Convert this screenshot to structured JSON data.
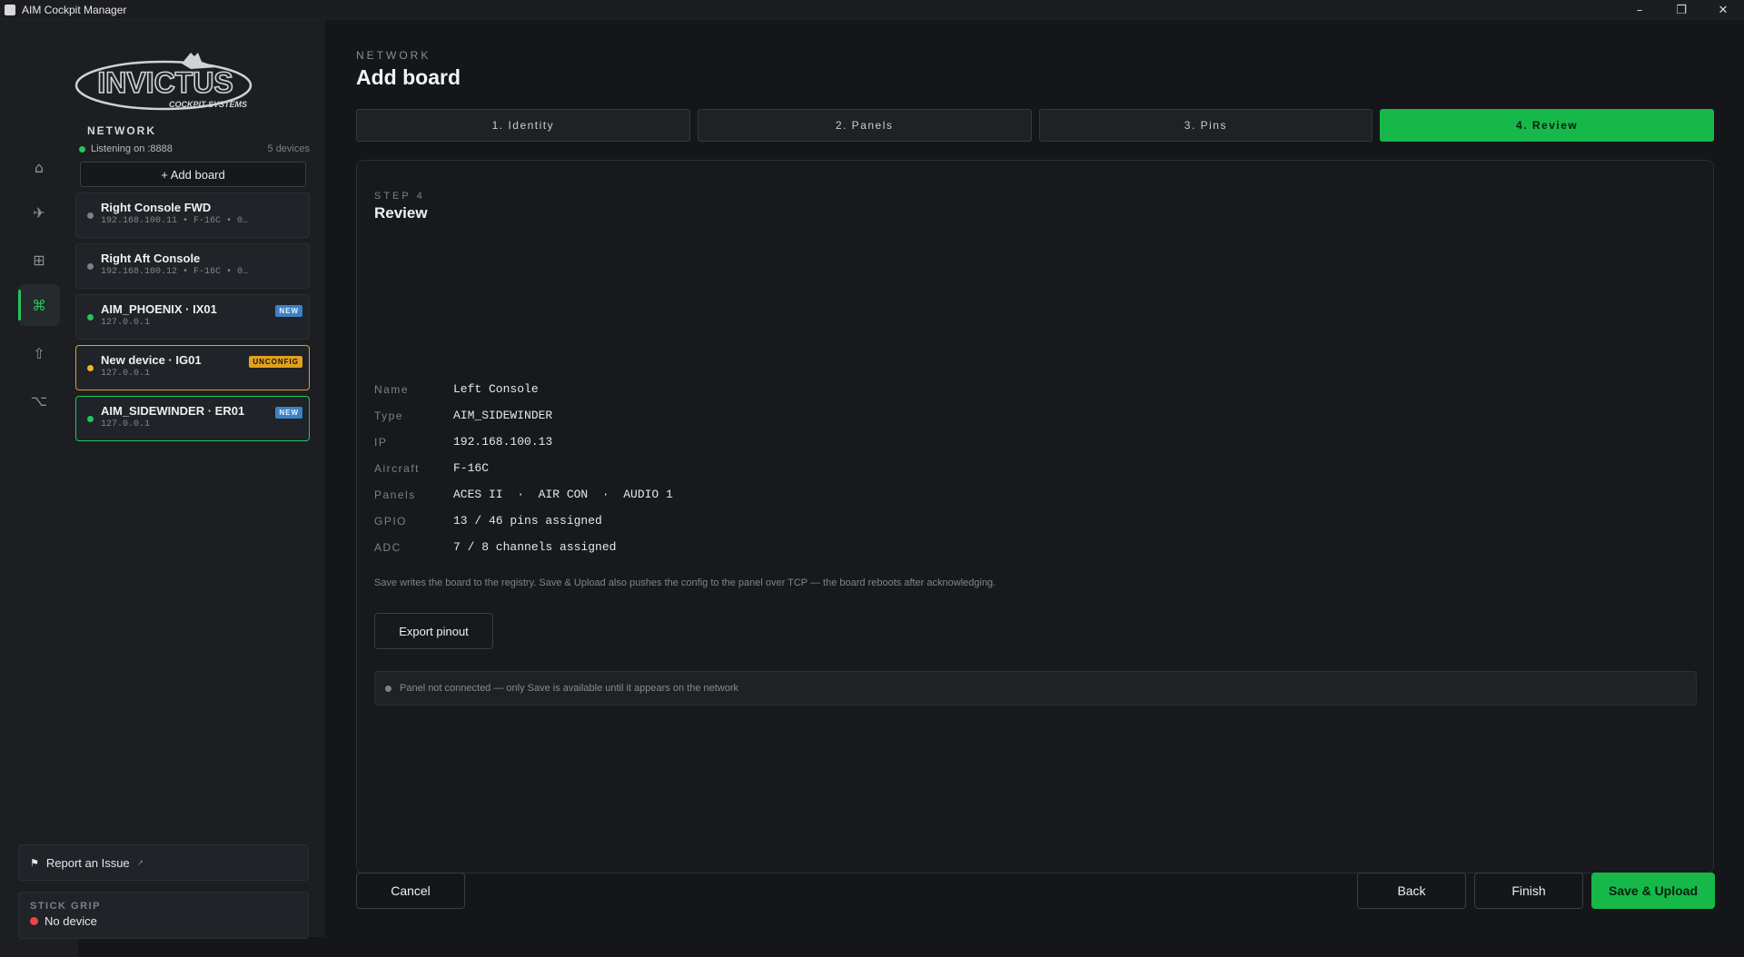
{
  "window": {
    "title": "AIM Cockpit Manager"
  },
  "sidebar": {
    "section_label": "NETWORK",
    "listening": "Listening on :8888",
    "device_count": "5 devices",
    "add_board_label": "+ Add board",
    "boards": [
      {
        "name": "Right Console FWD",
        "sub": "192.168.100.11  •  F-16C  •  0…",
        "status": "gray",
        "badge": ""
      },
      {
        "name": "Right Aft Console",
        "sub": "192.168.100.12  •  F-16C  •  0…",
        "status": "gray",
        "badge": ""
      },
      {
        "name": "AIM_PHOENIX · IX01",
        "sub": "127.0.0.1",
        "status": "green",
        "badge": "NEW"
      },
      {
        "name": "New device · IG01",
        "sub": "127.0.0.1",
        "status": "amber",
        "badge": "UNCONFIG"
      },
      {
        "name": "AIM_SIDEWINDER · ER01",
        "sub": "127.0.0.1",
        "status": "green",
        "badge": "NEW"
      }
    ],
    "report_label": "Report an Issue",
    "report_ext": "↗",
    "stick_label": "STICK GRIP",
    "stick_value": "No device"
  },
  "logo": {
    "main": "INVICTUS",
    "sub": "COCKPIT SYSTEMS"
  },
  "main": {
    "crumb": "NETWORK",
    "title": "Add board",
    "steps": [
      "1. Identity",
      "2. Panels",
      "3. Pins",
      "4. Review"
    ],
    "step_kicker": "STEP 4",
    "step_title": "Review",
    "review": [
      {
        "key": "Name",
        "value": "Left Console"
      },
      {
        "key": "Type",
        "value": "AIM_SIDEWINDER"
      },
      {
        "key": "IP",
        "value": "192.168.100.13"
      },
      {
        "key": "Aircraft",
        "value": "F-16C"
      },
      {
        "key": "Panels",
        "value": "ACES II  ·  AIR CON  ·  AUDIO 1"
      },
      {
        "key": "GPIO",
        "value": "13 / 46 pins assigned"
      },
      {
        "key": "ADC",
        "value": "7 / 8 channels assigned"
      }
    ],
    "note": "Save writes the board to the registry. Save & Upload also pushes the config to the panel over TCP — the board reboots after acknowledging.",
    "export_label": "Export pinout",
    "notice": "Panel not connected — only Save is available until it appears on the network",
    "buttons": {
      "cancel": "Cancel",
      "back": "Back",
      "finish": "Finish",
      "upload": "Save & Upload"
    }
  },
  "colors": {
    "accent": "#16b84a",
    "warning": "#e0a020",
    "badge_new": "#3b82c4",
    "error": "#ef4444"
  }
}
